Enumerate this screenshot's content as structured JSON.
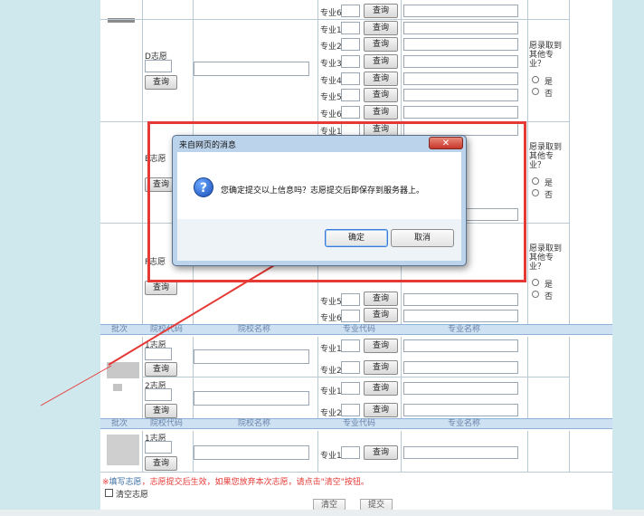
{
  "form": {
    "d_choice_label": "D志愿",
    "e_choice_label": "E志愿",
    "f_choice_label": "F志愿",
    "query_label": "查询",
    "major_labels": [
      "专业1",
      "专业2",
      "专业3",
      "专业4",
      "专业5",
      "专业6"
    ],
    "accept_other_text": "愿录取到其他专业？",
    "yes_label": "是",
    "no_label": "否",
    "headers": [
      "批次",
      "院校代码",
      "院校名称",
      "专业代码",
      "专业名称"
    ],
    "choice_1_label": "1志愿",
    "choice_2_label": "2志愿",
    "note_star": "※",
    "note_link": "填写志愿",
    "note_text": "，志愿提交后生效，如果您放弃本次志愿，请点击\"清空\"按钮。",
    "clear_checkbox_label": "清空志愿",
    "clear_button": "清空",
    "submit_button": "提交"
  },
  "dialog": {
    "title": "来自网页的消息",
    "close_symbol": "✕",
    "icon_symbol": "?",
    "message": "您确定提交以上信息吗？志愿提交后即保存到服务器上。",
    "ok_label": "确定",
    "cancel_label": "取消"
  },
  "colors": {
    "highlight_red": "#e53935",
    "header_bg": "#cde1f3",
    "page_bg": "#cfe8ee"
  }
}
